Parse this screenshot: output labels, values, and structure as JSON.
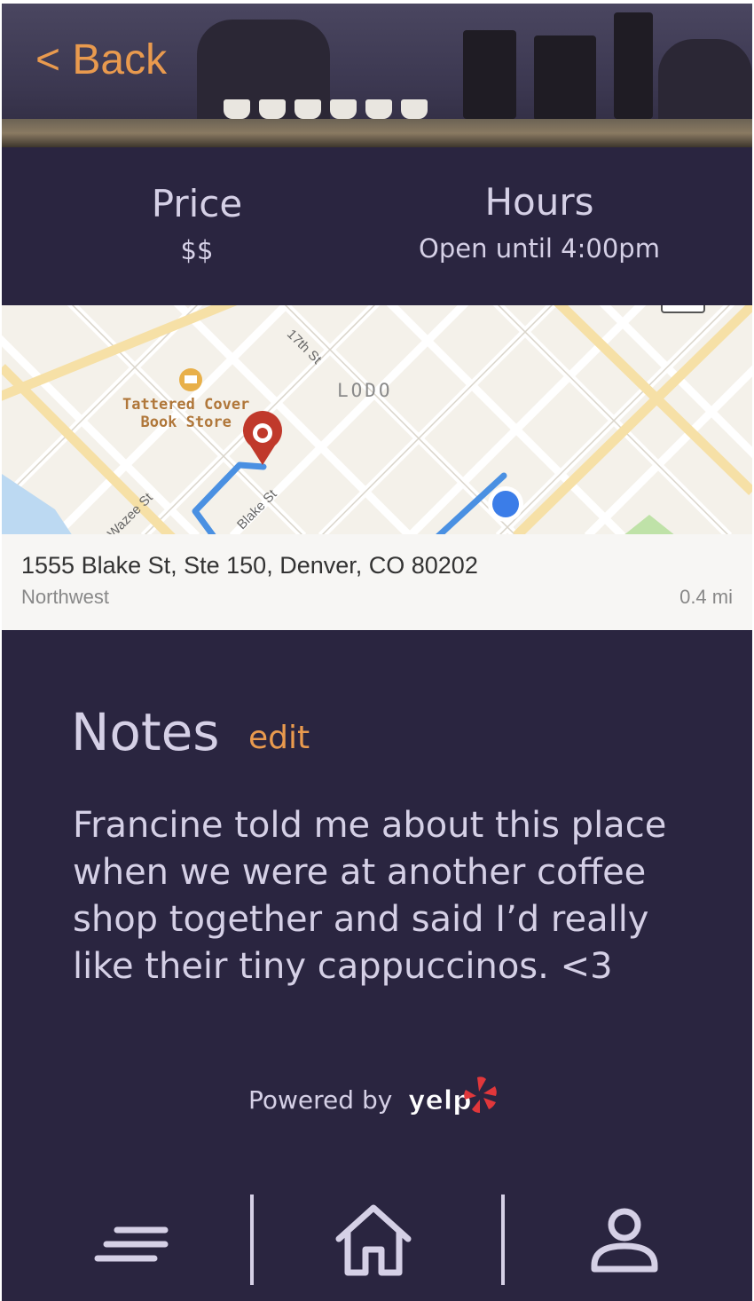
{
  "header": {
    "back_label": "< Back"
  },
  "info": {
    "price_label": "Price",
    "price_value": "$$",
    "hours_label": "Hours",
    "hours_value": "Open until 4:00pm"
  },
  "map": {
    "street_labels": [
      "17th St",
      "Blake St",
      "Wazee St"
    ],
    "district_label": "LODO",
    "poi_name_line1": "Tattered Cover",
    "poi_name_line2": "Book Store",
    "address": "1555 Blake St, Ste 150, Denver, CO 80202",
    "area": "Northwest",
    "distance": "0.4 mi",
    "colors": {
      "route": "#4a90e2",
      "user_dot": "#3b7de8",
      "pin": "#c0392b"
    }
  },
  "notes": {
    "title": "Notes",
    "edit_label": "edit",
    "body": "Francine told me about this place when we were at another coffee shop together and said I’d really like their tiny cappuccinos. <3"
  },
  "footer": {
    "powered_by": "Powered by",
    "brand": "yelp"
  },
  "nav": {
    "icons": [
      "menu-icon",
      "home-icon",
      "profile-icon"
    ]
  },
  "theme": {
    "background": "#2a2540",
    "text": "#d5d0e6",
    "accent": "#e99a4e"
  }
}
